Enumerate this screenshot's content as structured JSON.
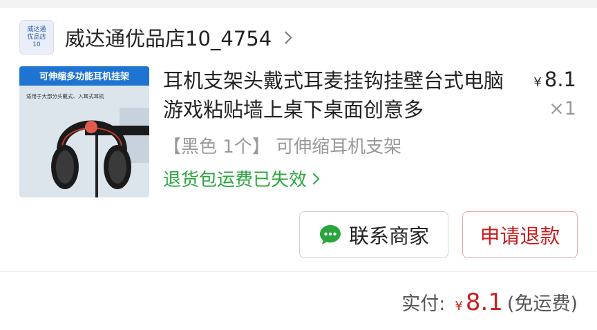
{
  "shop": {
    "logo_lines": [
      "威达通",
      "优品店",
      "10"
    ],
    "name": "威达通优品店10_4754"
  },
  "product": {
    "thumb_banner": "可伸缩多功能耳机挂架",
    "thumb_caption": "适用于大部分头戴式、入耳式耳机",
    "title": "耳机支架头戴式耳麦挂钩挂壁台式电脑游戏粘贴墙上桌下桌面创意多",
    "currency_symbol": "¥",
    "price": "8.1",
    "quantity": "×1",
    "spec": "【黑色 1个】 可伸缩耳机支架",
    "return_note": "退货包运费已失效"
  },
  "actions": {
    "contact_label": "联系商家",
    "refund_label": "申请退款"
  },
  "summary": {
    "label": "实付:",
    "currency_symbol": "¥",
    "amount": "8.1",
    "note": "(免运费)"
  },
  "colors": {
    "accent_red": "#c81f1f",
    "green": "#2aa53e",
    "thumb_blue": "#1f74d2"
  }
}
